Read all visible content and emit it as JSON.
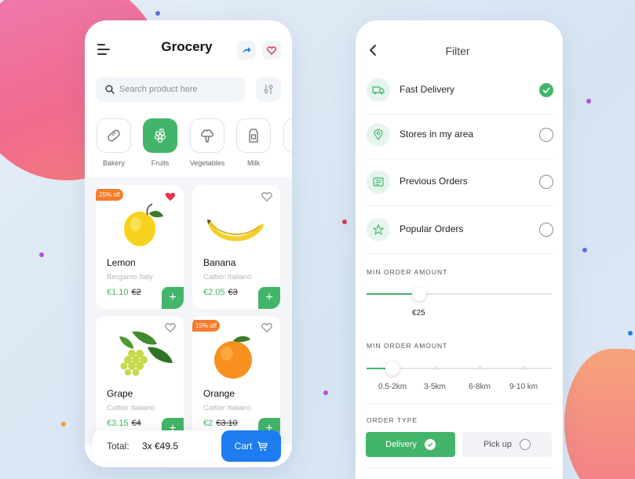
{
  "grocery": {
    "title": "Grocery",
    "search_placeholder": "Search product here",
    "categories": [
      {
        "label": "Bakery",
        "icon": "bread-icon"
      },
      {
        "label": "Fruits",
        "icon": "grapes-icon"
      },
      {
        "label": "Vegetables",
        "icon": "broccoli-icon"
      },
      {
        "label": "Milk",
        "icon": "milk-carton-icon"
      }
    ],
    "products": [
      {
        "name": "Lemon",
        "origin": "Bergamo Italy",
        "price": "€1.10",
        "old_price": "€2",
        "badge": "25% off",
        "favorited": true
      },
      {
        "name": "Banana",
        "origin": "Cattier Italiano",
        "price": "€2.05",
        "old_price": "€3",
        "badge": "",
        "favorited": false
      },
      {
        "name": "Grape",
        "origin": "Cattier Italiano",
        "price": "€3.15",
        "old_price": "€4",
        "badge": "",
        "favorited": false
      },
      {
        "name": "Orange",
        "origin": "Cattier Italiano",
        "price": "€2",
        "old_price": "€3.10",
        "badge": "15% off",
        "favorited": false
      }
    ],
    "cart": {
      "total_label": "Total:",
      "total_value": "3x €49.5",
      "button_label": "Cart"
    }
  },
  "filter": {
    "title": "Filter",
    "options": [
      {
        "label": "Fast Delivery",
        "icon": "truck-icon",
        "checked": true
      },
      {
        "label": "Stores in my area",
        "icon": "location-pin-icon",
        "checked": false
      },
      {
        "label": "Previous Orders",
        "icon": "receipt-icon",
        "checked": false
      },
      {
        "label": "Popular Orders",
        "icon": "star-icon",
        "checked": false
      }
    ],
    "min_order_1": {
      "label": "MIN ORDER AMOUNT",
      "value": "€25"
    },
    "min_order_2": {
      "label": "MIN ORDER AMOUNT",
      "steps": [
        "0.5-2km",
        "3-5km",
        "6-8km",
        "9-10 km"
      ],
      "selected_index": 0
    },
    "order_type": {
      "label": "ORDER TYPE",
      "delivery_label": "Delivery",
      "pickup_label": "Pick up",
      "selected": "Delivery"
    }
  },
  "colors": {
    "green": "#43b56a",
    "blue": "#1e7cf0",
    "orange_badge": "#f47c2c",
    "heart_red": "#e8334a"
  }
}
